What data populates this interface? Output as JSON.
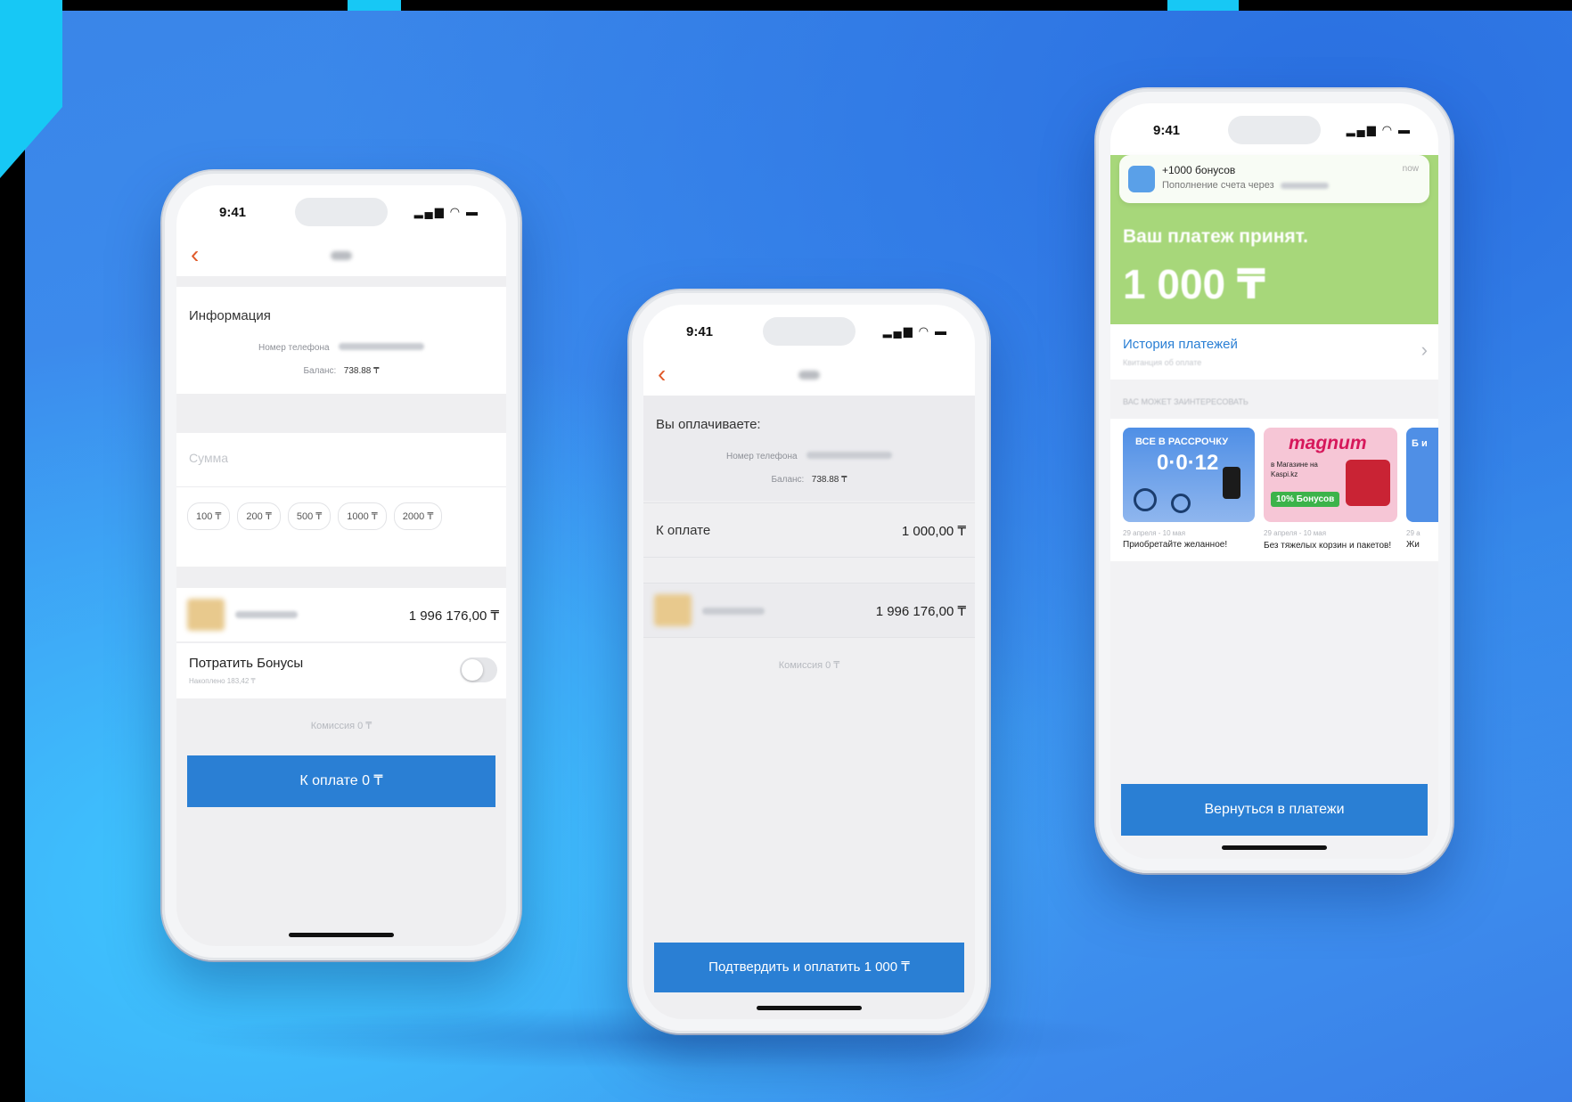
{
  "status_time": "9:41",
  "phone1": {
    "info_title": "Информация",
    "phone_label": "Номер телефона",
    "balance_label": "Баланс:",
    "balance_value": "738.88 ₸",
    "amount_placeholder": "Сумма",
    "chips": [
      "100 ₸",
      "200 ₸",
      "500 ₸",
      "1000 ₸",
      "2000 ₸"
    ],
    "account_amount": "1 996 176,00 ₸",
    "bonus_title": "Потратить Бонусы",
    "bonus_sub": "Накоплено 183,42 ₸",
    "commission": "Комиссия 0 ₸",
    "pay_button": "К оплате 0 ₸"
  },
  "phone2": {
    "paying_title": "Вы оплачиваете:",
    "phone_label": "Номер телефона",
    "balance_label": "Баланс:",
    "balance_value": "738.88 ₸",
    "to_pay_label": "К оплате",
    "to_pay_value": "1 000,00 ₸",
    "account_amount": "1 996 176,00 ₸",
    "commission": "Комиссия 0 ₸",
    "confirm_button": "Подтвердить и оплатить 1 000 ₸"
  },
  "phone3": {
    "notif_title": "+1000 бонусов",
    "notif_body": "Пополнение счета через",
    "notif_time": "now",
    "accepted_text": "Ваш платеж принят.",
    "amount": "1 000 ₸",
    "history_title": "История платежей",
    "history_sub": "Квитанция об оплате",
    "section_label": "ВАС МОЖЕТ ЗАИНТЕРЕСОВАТЬ",
    "promos": [
      {
        "banner_top": "ВСЕ В РАССРОЧКУ",
        "banner_big": "0·0·12",
        "date": "29 апреля - 10 мая",
        "caption": "Приобретайте желанное!"
      },
      {
        "banner_top": "magnum",
        "banner_sub": "в Магазине на Kaspi.kz",
        "banner_badge": "10% Бонусов",
        "date": "29 апреля - 10 мая",
        "caption": "Без тяжелых корзин и пакетов!"
      },
      {
        "banner_top": "Б и",
        "date": "29 а",
        "caption": "Жи"
      }
    ],
    "return_button": "Вернуться в платежи"
  },
  "colors": {
    "accent_blue": "#2a7fd4",
    "back_orange": "#e05a2a",
    "success_green": "#a7d77a",
    "background": "#3d8ff0"
  }
}
